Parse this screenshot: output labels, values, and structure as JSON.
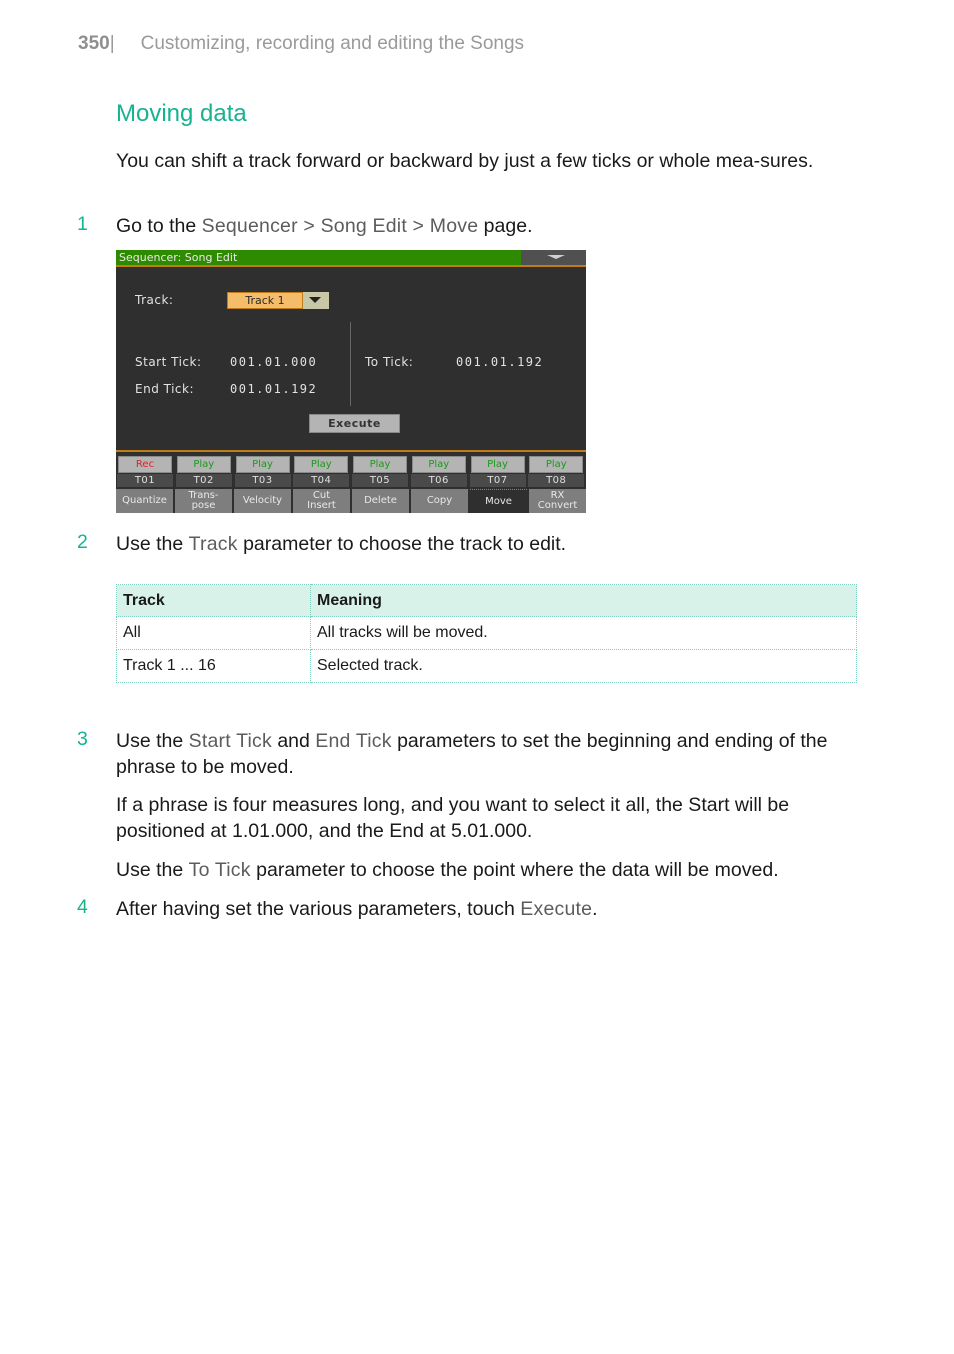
{
  "header": {
    "page_number": "350",
    "separator": "|",
    "chapter": "Customizing, recording and editing the Songs"
  },
  "section_title": "Moving data",
  "intro": "You can shift a track forward or backward by just a few ticks or whole mea-sures.",
  "steps": [
    {
      "number": "1",
      "parts": [
        "Go to the ",
        "Sequencer > Song Edit > Move",
        " page."
      ]
    },
    {
      "number": "2",
      "parts": [
        "Use the ",
        "Track",
        " parameter to choose the track to edit."
      ]
    },
    {
      "number": "3",
      "parts": [
        "Use the ",
        "Start Tick",
        " and ",
        "End Tick",
        " parameters to set the beginning and ending of the phrase to be moved."
      ],
      "notes": [
        "If a phrase is four measures long, and you want to select it all, the Start will be positioned at 1.01.000, and the End at 5.01.000.",
        {
          "parts": [
            "Use the ",
            "To Tick",
            " parameter to choose the point where the data will be moved."
          ]
        }
      ]
    },
    {
      "number": "4",
      "parts": [
        "After having set the various parameters, touch ",
        "Execute",
        "."
      ]
    }
  ],
  "screen": {
    "title": "Sequencer: Song Edit",
    "track_label": "Track:",
    "track_value": "Track 1",
    "start_tick_label": "Start Tick:",
    "start_tick_value": "001.01.000",
    "end_tick_label": "End Tick:",
    "end_tick_value": "001.01.192",
    "to_tick_label": "To Tick:",
    "to_tick_value": "001.01.192",
    "execute_label": "Execute",
    "tracks": [
      {
        "name": "T01",
        "mode": "Rec"
      },
      {
        "name": "T02",
        "mode": "Play"
      },
      {
        "name": "T03",
        "mode": "Play"
      },
      {
        "name": "T04",
        "mode": "Play"
      },
      {
        "name": "T05",
        "mode": "Play"
      },
      {
        "name": "T06",
        "mode": "Play"
      },
      {
        "name": "T07",
        "mode": "Play"
      },
      {
        "name": "T08",
        "mode": "Play"
      }
    ],
    "tabs": [
      {
        "label": "Quantize",
        "active": false
      },
      {
        "label": "Trans-\npose",
        "active": false
      },
      {
        "label": "Velocity",
        "active": false
      },
      {
        "label": "Cut\nInsert",
        "active": false
      },
      {
        "label": "Delete",
        "active": false
      },
      {
        "label": "Copy",
        "active": false
      },
      {
        "label": "Move",
        "active": true
      },
      {
        "label": "RX\nConvert",
        "active": false
      }
    ],
    "colors": {
      "title_bar": "#2e8b00",
      "accent": "#c07c18",
      "selector": "#f5bd69",
      "rec": "#e02020",
      "play": "#1a9a1a"
    }
  },
  "table": {
    "headers": [
      "Track",
      "Meaning"
    ],
    "rows": [
      [
        "All",
        "All tracks will be moved."
      ],
      [
        "Track 1 ... 16",
        "Selected track."
      ]
    ]
  },
  "colors": {
    "accent": "#17b38f",
    "keyword": "#5c5c5c",
    "header_text": "#9a9a9a",
    "table_header_bg": "#d8f2ea"
  }
}
